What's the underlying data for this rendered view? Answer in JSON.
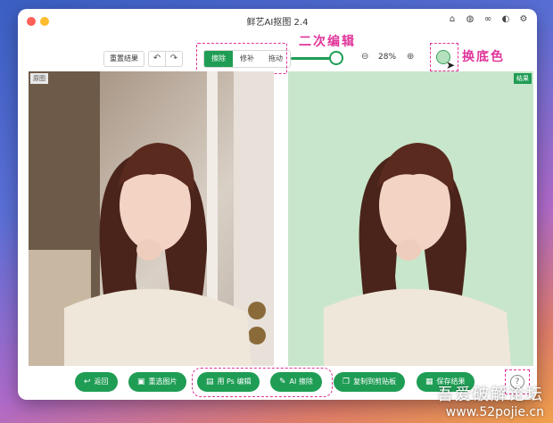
{
  "window": {
    "title": "鲜艺AI抠图 2.4"
  },
  "titlebar_icons": [
    "home-icon",
    "globe-icon",
    "link-icon",
    "contrast-icon",
    "gear-icon"
  ],
  "toolbar": {
    "restore_label": "重置结果",
    "modes": [
      {
        "label": "擦除",
        "active": true
      },
      {
        "label": "修补",
        "active": false
      },
      {
        "label": "拖动",
        "active": false
      }
    ],
    "brush_size_fraction": 0.9,
    "zoom_label": "28%",
    "bg_color": "#b5e0be"
  },
  "annotations": {
    "edit": "二次编辑",
    "change_bg": "换底色"
  },
  "panels": {
    "left_tag": "原图",
    "right_tag": "结果",
    "result_bg": "#c8e6cb"
  },
  "bottom_buttons": [
    {
      "label": "返回",
      "icon": "back-icon"
    },
    {
      "label": "重选图片",
      "icon": "image-icon"
    },
    {
      "label": "用 Ps 编辑",
      "icon": "ps-icon"
    },
    {
      "label": "AI 擦除",
      "icon": "eraser-icon"
    },
    {
      "label": "复制到剪贴板",
      "icon": "copy-icon"
    },
    {
      "label": "保存结果",
      "icon": "save-icon"
    }
  ],
  "watermark": {
    "line1": "吾爱破解论坛",
    "line2": "www.52pojie.cn"
  },
  "colors": {
    "accent": "#1f9d55",
    "annotation": "#e0359a"
  }
}
